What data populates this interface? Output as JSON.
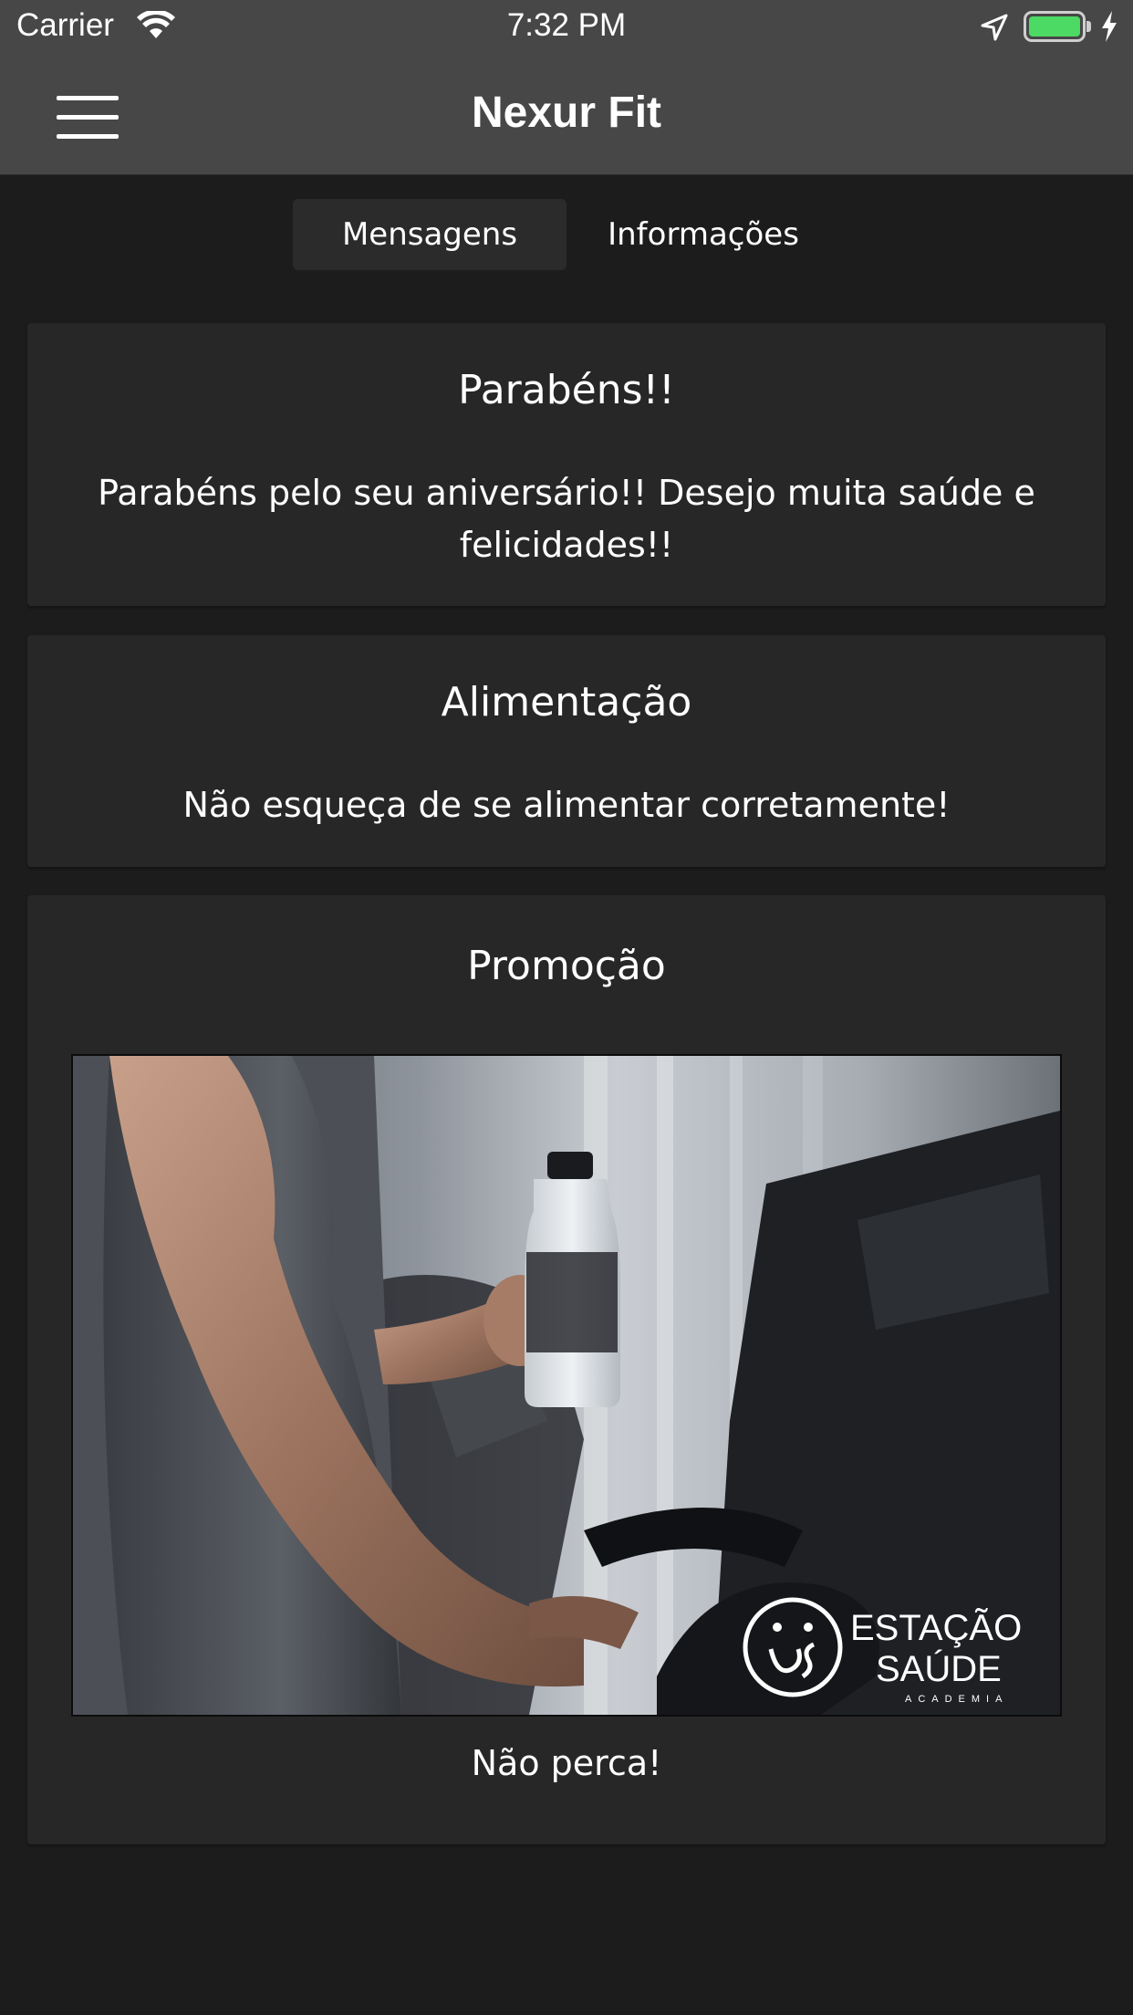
{
  "status_bar": {
    "carrier": "Carrier",
    "time": "7:32 PM",
    "icons": [
      "wifi-icon",
      "location-arrow-icon",
      "battery-icon",
      "charging-bolt-icon"
    ],
    "battery_level": 1.0,
    "battery_color": "#4cd964"
  },
  "nav": {
    "title": "Nexur Fit",
    "menu_icon": "hamburger-menu-icon"
  },
  "tabs": [
    {
      "label": "Mensagens",
      "selected": true
    },
    {
      "label": "Informações",
      "selected": false
    }
  ],
  "messages": [
    {
      "title": "Parabéns!!",
      "body": "Parabéns pelo seu aniversário!! Desejo muita saúde e felicidades!!"
    },
    {
      "title": "Alimentação",
      "body": "Não esqueça de se alimentar corretamente!"
    },
    {
      "title": "Promoção",
      "image_logo": {
        "line1": "ESTAÇÃO",
        "line2": "SAÚDE",
        "line3": "ACADEMIA"
      },
      "body": "Não perca!"
    }
  ],
  "colors": {
    "bar_background": "#474747",
    "page_background": "#1c1c1c",
    "card_background": "#272727",
    "segment_selected": "#2b2b2b",
    "text": "#ffffff"
  }
}
